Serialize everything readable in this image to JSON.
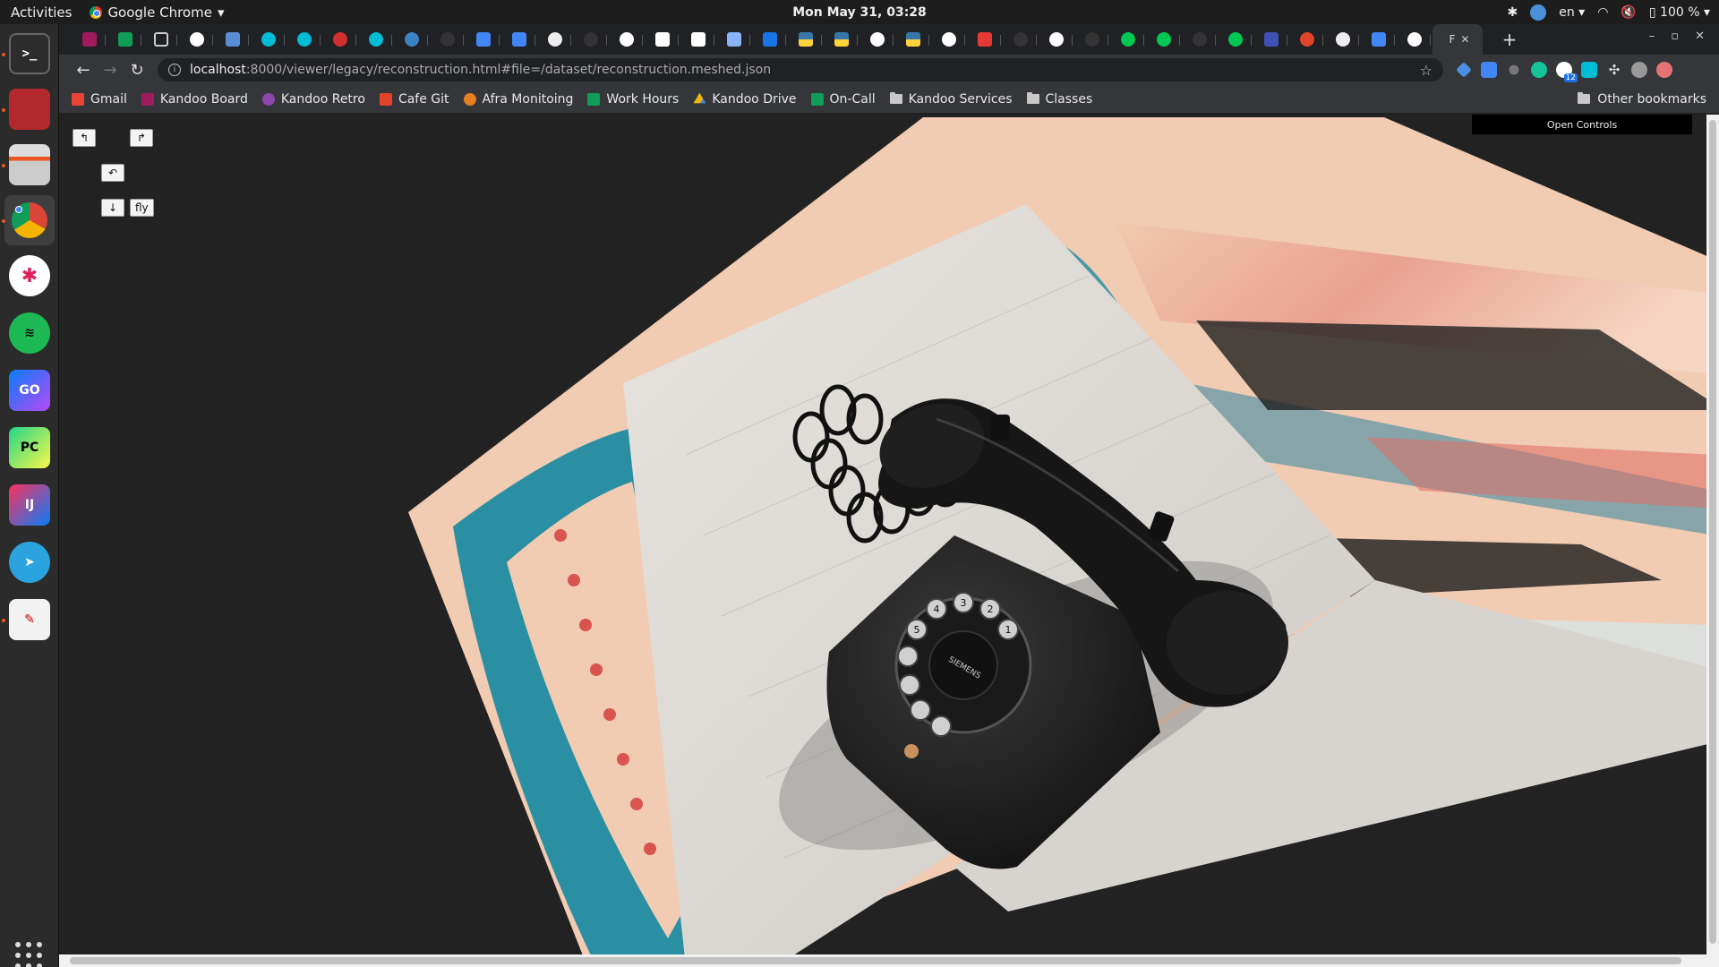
{
  "topbar": {
    "activities": "Activities",
    "app_name": "Google Chrome",
    "clock": "Mon May 31, 03:28",
    "language": "en",
    "battery": "100 %"
  },
  "browser": {
    "active_tab_title": "F",
    "url_host": "localhost",
    "url_rest": ":8000/viewer/legacy/reconstruction.html#file=/dataset/reconstruction.meshed.json",
    "extension_badge": "12"
  },
  "bookmarks": [
    {
      "label": "Gmail",
      "color": "#ea4335"
    },
    {
      "label": "Kandoo Board",
      "color": "#a01a5e"
    },
    {
      "label": "Kandoo Retro",
      "color": "#8e44ad"
    },
    {
      "label": "Cafe Git",
      "color": "#e24329"
    },
    {
      "label": "Afra Monitoing",
      "color": "#e67e22"
    },
    {
      "label": "Work Hours",
      "color": "#0f9d58"
    },
    {
      "label": "Kandoo Drive",
      "color": "#f4b400"
    },
    {
      "label": "On-Call",
      "color": "#0f9d58"
    },
    {
      "label": "Kandoo Services",
      "color": "folder"
    },
    {
      "label": "Classes",
      "color": "folder"
    }
  ],
  "other_bookmarks": "Other bookmarks",
  "viewer": {
    "controls": {
      "rotate_left": "↰",
      "rotate_right": "↱",
      "undo": "↶",
      "down": "↓",
      "fly": "fly"
    },
    "open_controls": "Open Controls",
    "phone_brand": "SIEMENS",
    "dial_digits": [
      "1",
      "2",
      "3",
      "4",
      "5"
    ]
  }
}
